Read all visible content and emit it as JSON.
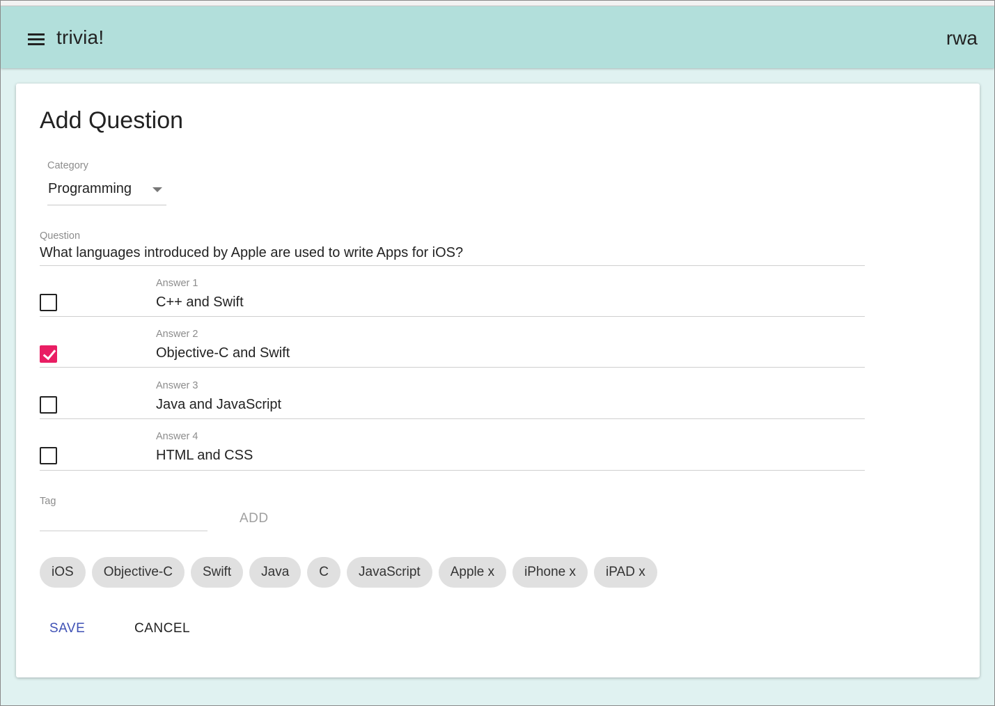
{
  "app": {
    "title": "trivia!",
    "user": "rwa",
    "accent_color": "#b2dfdb",
    "background_color": "#e0f2f1",
    "menu_icon": "hamburger-menu-icon"
  },
  "form": {
    "title": "Add Question",
    "category": {
      "label": "Category",
      "selected": "Programming"
    },
    "question": {
      "label": "Question",
      "value": "What languages introduced by Apple are used to write Apps for iOS?"
    },
    "answers": [
      {
        "label": "Answer 1",
        "value": "C++ and Swift",
        "correct": false
      },
      {
        "label": "Answer 2",
        "value": "Objective-C and Swift",
        "correct": true
      },
      {
        "label": "Answer 3",
        "value": "Java and JavaScript",
        "correct": false
      },
      {
        "label": "Answer 4",
        "value": "HTML and CSS",
        "correct": false
      }
    ],
    "checkbox_checked_color": "#e91e63",
    "tag": {
      "label": "Tag",
      "value": "",
      "add_label": "ADD"
    },
    "tags": [
      "iOS",
      "Objective-C",
      "Swift",
      "Java",
      "C",
      "JavaScript",
      "Apple x",
      "iPhone x",
      "iPAD x"
    ],
    "save_label": "SAVE",
    "cancel_label": "CANCEL",
    "save_color": "#3f51b5"
  }
}
